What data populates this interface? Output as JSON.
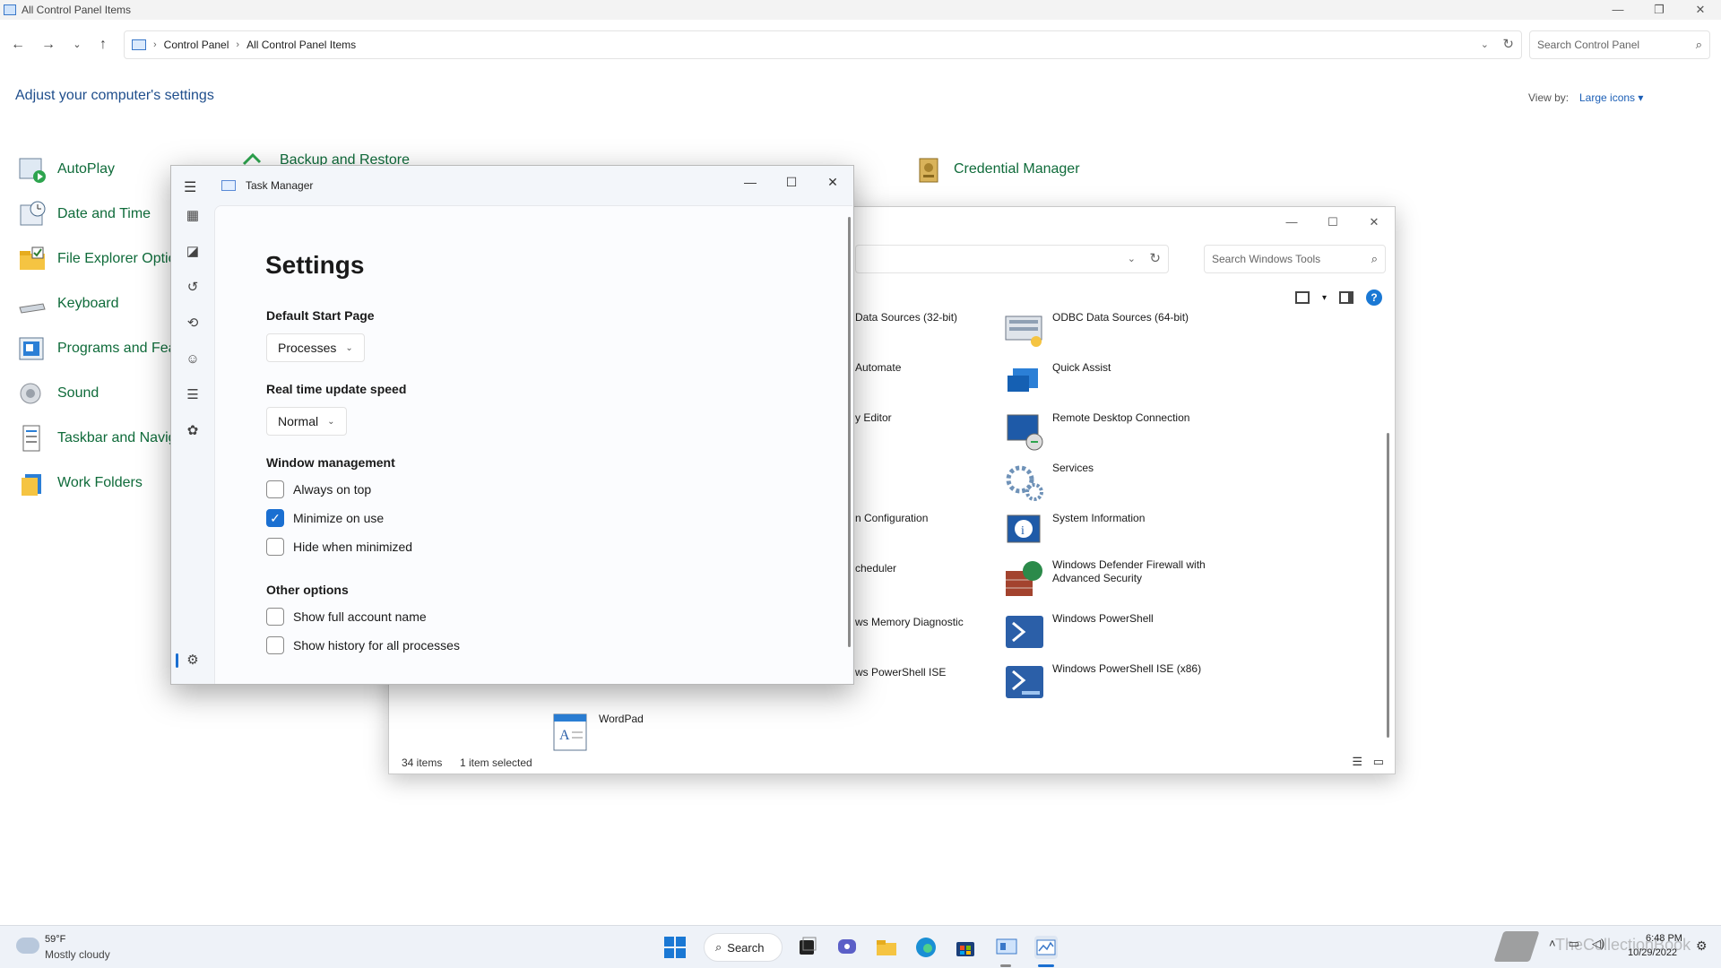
{
  "control_panel": {
    "title": "All Control Panel Items",
    "breadcrumb": [
      "Control Panel",
      "All Control Panel Items"
    ],
    "search_placeholder": "Search Control Panel",
    "heading": "Adjust your computer's settings",
    "view_by_label": "View by:",
    "view_by_value": "Large icons",
    "items": [
      {
        "label": "AutoPlay",
        "icon": "autoplay-icon"
      },
      {
        "label": "Date and Time",
        "icon": "clock-icon"
      },
      {
        "label": "File Explorer Optio",
        "icon": "folder-icon"
      },
      {
        "label": "Keyboard",
        "icon": "keyboard-icon"
      },
      {
        "label": "Programs and Feat",
        "icon": "programs-icon"
      },
      {
        "label": "Sound",
        "icon": "speaker-icon"
      },
      {
        "label": "Taskbar and Navig",
        "icon": "taskbar-icon"
      },
      {
        "label": "Work Folders",
        "icon": "work-folders-icon"
      },
      {
        "label": "Backup and Restore",
        "icon": "backup-icon"
      },
      {
        "label": "Credential Manager",
        "icon": "credential-icon"
      }
    ]
  },
  "windows_tools": {
    "search_placeholder": "Search Windows Tools",
    "items": [
      {
        "label": "Data Sources (32-bit)",
        "icon": "odbc-icon"
      },
      {
        "label": "Automate",
        "icon": "automate-icon"
      },
      {
        "label": "y Editor",
        "icon": "registry-icon"
      },
      {
        "label": "n Configuration",
        "icon": "config-icon"
      },
      {
        "label": "cheduler",
        "icon": "scheduler-icon"
      },
      {
        "label": "ws Memory Diagnostic",
        "icon": "memory-icon"
      },
      {
        "label": "ws PowerShell ISE",
        "icon": "powershell-ise-icon"
      },
      {
        "label": "ODBC Data Sources (64-bit)",
        "icon": "odbc-icon"
      },
      {
        "label": "Quick Assist",
        "icon": "quick-assist-icon"
      },
      {
        "label": "Remote Desktop Connection",
        "icon": "remote-desktop-icon"
      },
      {
        "label": "Services",
        "icon": "gears-icon"
      },
      {
        "label": "System Information",
        "icon": "info-icon"
      },
      {
        "label": "Windows Defender Firewall with Advanced Security",
        "icon": "firewall-icon"
      },
      {
        "label": "Windows PowerShell",
        "icon": "powershell-icon"
      },
      {
        "label": "Windows PowerShell ISE (x86)",
        "icon": "powershell-ise-icon"
      },
      {
        "label": "WordPad",
        "icon": "wordpad-icon"
      }
    ],
    "status_count": "34 items",
    "status_selected": "1 item selected"
  },
  "task_manager": {
    "title": "Task Manager",
    "heading": "Settings",
    "default_start_label": "Default Start Page",
    "default_start_value": "Processes",
    "update_speed_label": "Real time update speed",
    "update_speed_value": "Normal",
    "window_mgmt_label": "Window management",
    "window_mgmt_options": [
      {
        "label": "Always on top",
        "checked": false
      },
      {
        "label": "Minimize on use",
        "checked": true
      },
      {
        "label": "Hide when minimized",
        "checked": false
      }
    ],
    "other_label": "Other options",
    "other_options": [
      {
        "label": "Show full account name",
        "checked": false
      },
      {
        "label": "Show history for all processes",
        "checked": false
      }
    ]
  },
  "taskbar": {
    "weather_temp": "59°F",
    "weather_desc": "Mostly cloudy",
    "search_label": "Search",
    "time": "6:48 PM",
    "date": "10/29/2022",
    "watermark": "TheCollectionBook"
  },
  "colors": {
    "accent": "#1a6fd1",
    "cp_link": "#0f6b3a",
    "cp_heading": "#1f4e8c"
  }
}
